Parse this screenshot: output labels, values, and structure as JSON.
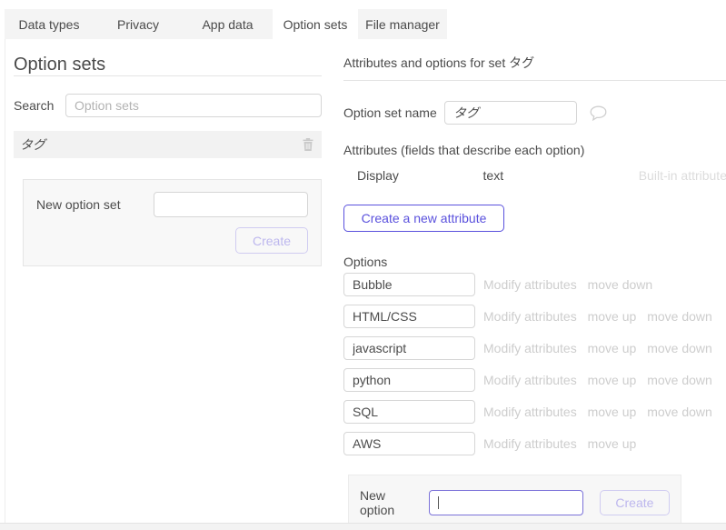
{
  "colors": {
    "accent": "#5a51dd",
    "focus_border": "#7b72d9",
    "muted_link": "#cdcdcd",
    "disabled_button_text": "#bdb7ee",
    "tab_background": "#f4f4f4",
    "selected_row_background": "#f2f2f2"
  },
  "tabs": [
    {
      "label": "Data types"
    },
    {
      "label": "Privacy"
    },
    {
      "label": "App data"
    },
    {
      "label": "Option sets",
      "active": true
    },
    {
      "label": "File manager"
    }
  ],
  "left_panel": {
    "title": "Option sets",
    "search": {
      "label": "Search",
      "placeholder": "Option sets",
      "value": ""
    },
    "sets": [
      {
        "name": "タグ"
      }
    ],
    "new_set": {
      "label": "New option set",
      "value": "",
      "create_label": "Create"
    }
  },
  "right_panel": {
    "title": "Attributes and options for set タグ",
    "name_field": {
      "label": "Option set name",
      "value": "タグ"
    },
    "attributes_heading": "Attributes (fields that describe each option)",
    "attribute_rows": [
      {
        "name": "Display",
        "type": "text",
        "note": "Built-in attribute"
      }
    ],
    "create_attribute_label": "Create a new attribute",
    "options_heading": "Options",
    "options": [
      {
        "value": "Bubble",
        "links": [
          "Modify attributes",
          "move down"
        ]
      },
      {
        "value": "HTML/CSS",
        "links": [
          "Modify attributes",
          "move up",
          "move down"
        ]
      },
      {
        "value": "javascript",
        "links": [
          "Modify attributes",
          "move up",
          "move down"
        ]
      },
      {
        "value": "python",
        "links": [
          "Modify attributes",
          "move up",
          "move down"
        ]
      },
      {
        "value": "SQL",
        "links": [
          "Modify attributes",
          "move up",
          "move down"
        ]
      },
      {
        "value": "AWS",
        "links": [
          "Modify attributes",
          "move up"
        ]
      }
    ],
    "new_option": {
      "label": "New option",
      "value": "",
      "create_label": "Create"
    }
  }
}
